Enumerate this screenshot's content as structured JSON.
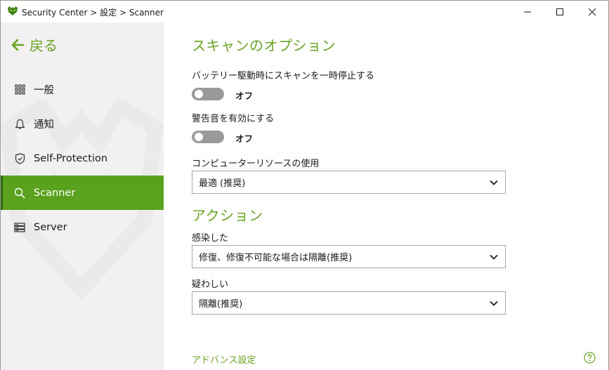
{
  "window": {
    "title": "Security Center > 設定 > Scanner",
    "minimize_icon": "minimize-icon",
    "maximize_icon": "maximize-icon",
    "close_icon": "close-icon"
  },
  "sidebar": {
    "back_label": "戻る",
    "items": [
      {
        "label": "一般",
        "icon": "grid-icon",
        "active": false
      },
      {
        "label": "通知",
        "icon": "bell-icon",
        "active": false
      },
      {
        "label": "Self-Protection",
        "icon": "shield-icon",
        "active": false
      },
      {
        "label": "Scanner",
        "icon": "search-icon",
        "active": true
      },
      {
        "label": "Server",
        "icon": "server-icon",
        "active": false
      }
    ]
  },
  "main": {
    "options_title": "スキャンのオプション",
    "battery_pause": {
      "label": "バッテリー駆動時にスキャンを一時停止する",
      "state": "オフ",
      "on": false
    },
    "warning_sound": {
      "label": "警告音を有効にする",
      "state": "オフ",
      "on": false
    },
    "resource_usage": {
      "label": "コンピューターリソースの使用",
      "value": "最適 (推奨)"
    },
    "actions_title": "アクション",
    "infected": {
      "label": "感染した",
      "value": "修復、修復不可能な場合は隔離(推奨)"
    },
    "suspicious": {
      "label": "疑わしい",
      "value": "隔離(推奨)"
    },
    "advanced_link": "アドバンス設定",
    "help_icon": "help-icon"
  },
  "colors": {
    "accent": "#6aa222",
    "active_nav": "#5aa11e",
    "sidebar_bg": "#f1f1f1",
    "toggle_off": "#9a9a9a"
  }
}
